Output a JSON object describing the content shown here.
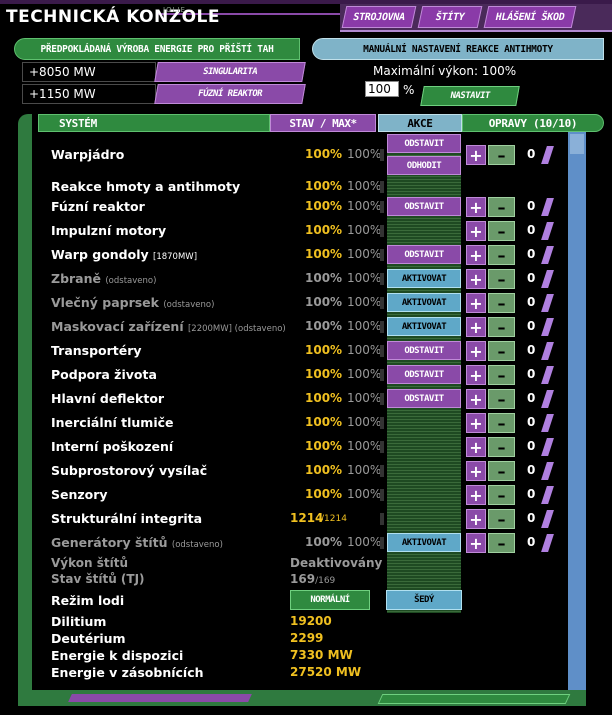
{
  "header": {
    "title": "TECHNICKÁ KONZOLE",
    "subtitle": "JOLIE",
    "nav": [
      "STROJOVNA",
      "ŠTÍTY",
      "HLÁŠENÍ ŠKOD"
    ]
  },
  "energy_panel": {
    "title": "PŘEDPOKLÁDANÁ VÝROBA ENERGIE PRO PŘÍŠTÍ TAH",
    "rows": [
      {
        "value": "+8050 MW",
        "label": "SINGULARITA"
      },
      {
        "value": "+1150 MW",
        "label": "FÚZNÍ REAKTOR"
      }
    ]
  },
  "antimatter_panel": {
    "title": "MANUÁLNÍ NASTAVENÍ REAKCE ANTIHMOTY",
    "max_power_label": "Maximální výkon: 100%",
    "input_value": "100",
    "unit": "%",
    "set_button": "NASTAVIT"
  },
  "table": {
    "headers": {
      "system": "SYSTÉM",
      "status": "STAV / MAX*",
      "action": "AKCE",
      "repairs": "OPRAVY (10/10)"
    },
    "rows": [
      {
        "name": "Warpjádro",
        "extra": "",
        "status": "100%",
        "max": "100%",
        "off": false,
        "actions": [
          "ODSTAVIT",
          "ODHODIT"
        ],
        "repairs": "0"
      },
      {
        "name": "Reakce hmoty a antihmoty",
        "extra": "",
        "status": "100%",
        "max": "100%",
        "off": false,
        "actions": [],
        "repairs": ""
      },
      {
        "name": "Fúzní reaktor",
        "extra": "",
        "status": "100%",
        "max": "100%",
        "off": false,
        "actions": [
          "ODSTAVIT"
        ],
        "repairs": "0"
      },
      {
        "name": "Impulzní motory",
        "extra": "",
        "status": "100%",
        "max": "100%",
        "off": false,
        "actions": [],
        "repairs": "0"
      },
      {
        "name": "Warp gondoly",
        "extra": "[1870MW]",
        "status": "100%",
        "max": "100%",
        "off": false,
        "actions": [
          "ODSTAVIT"
        ],
        "repairs": "0"
      },
      {
        "name": "Zbraně",
        "extra": "(odstaveno)",
        "status": "100%",
        "max": "100%",
        "off": true,
        "actions": [
          "AKTIVOVAT"
        ],
        "repairs": "0"
      },
      {
        "name": "Vlečný paprsek",
        "extra": "(odstaveno)",
        "status": "100%",
        "max": "100%",
        "off": true,
        "actions": [
          "AKTIVOVAT"
        ],
        "repairs": "0"
      },
      {
        "name": "Maskovací zařízení",
        "extra": "[2200MW] (odstaveno)",
        "status": "100%",
        "max": "100%",
        "off": true,
        "actions": [
          "AKTIVOVAT"
        ],
        "repairs": "0"
      },
      {
        "name": "Transportéry",
        "extra": "",
        "status": "100%",
        "max": "100%",
        "off": false,
        "actions": [
          "ODSTAVIT"
        ],
        "repairs": "0"
      },
      {
        "name": "Podpora života",
        "extra": "",
        "status": "100%",
        "max": "100%",
        "off": false,
        "actions": [
          "ODSTAVIT"
        ],
        "repairs": "0"
      },
      {
        "name": "Hlavní deflektor",
        "extra": "",
        "status": "100%",
        "max": "100%",
        "off": false,
        "actions": [
          "ODSTAVIT"
        ],
        "repairs": "0"
      },
      {
        "name": "Inerciální tlumiče",
        "extra": "",
        "status": "100%",
        "max": "100%",
        "off": false,
        "actions": [],
        "repairs": "0"
      },
      {
        "name": "Interní poškození",
        "extra": "",
        "status": "100%",
        "max": "100%",
        "off": false,
        "actions": [],
        "repairs": "0"
      },
      {
        "name": "Subprostorový vysílač",
        "extra": "",
        "status": "100%",
        "max": "100%",
        "off": false,
        "actions": [],
        "repairs": "0"
      },
      {
        "name": "Senzory",
        "extra": "",
        "status": "100%",
        "max": "100%",
        "off": false,
        "actions": [],
        "repairs": "0"
      },
      {
        "name": "Strukturální integrita",
        "extra": "",
        "status": "1214",
        "max": "/1214",
        "off": false,
        "actions": [],
        "repairs": "0"
      },
      {
        "name": "Generátory štítů",
        "extra": "(odstaveno)",
        "status": "100%",
        "max": "100%",
        "off": true,
        "actions": [
          "AKTIVOVAT"
        ],
        "repairs": "0"
      }
    ]
  },
  "info": {
    "shield_power_label": "Výkon štítů",
    "shield_power_value": "Deaktivovány",
    "shield_state_label": "Stav štítů (TJ)",
    "shield_state_value": "169",
    "shield_state_max": "/169",
    "ship_mode_label": "Režim lodi",
    "ship_mode_normal": "NORMÁLNÍ",
    "ship_mode_grey": "ŠEDÝ",
    "dilithium_label": "Dilitium",
    "dilithium_value": "19200",
    "deuterium_label": "Deutérium",
    "deuterium_value": "2299",
    "energy_available_label": "Energie k dispozici",
    "energy_available_value": "7330 MW",
    "energy_reserve_label": "Energie v zásobnících",
    "energy_reserve_value": "27520 MW"
  },
  "colors": {
    "purple": "#8a4aa8",
    "green": "#2f8a3f",
    "cyan": "#5fa8c8",
    "yellow": "#f0c020"
  }
}
